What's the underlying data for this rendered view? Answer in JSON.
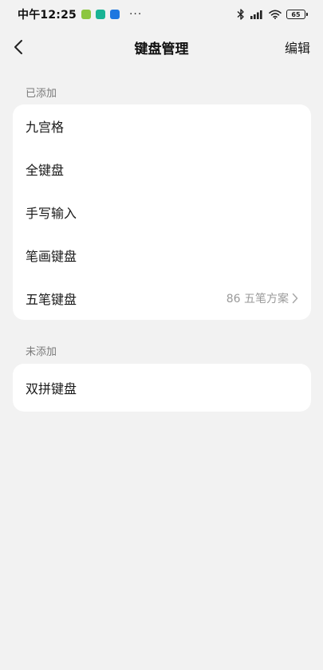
{
  "status_bar": {
    "time": "中午12:25",
    "dots": "···",
    "battery": "65"
  },
  "header": {
    "title": "键盘管理",
    "edit_label": "编辑"
  },
  "sections": {
    "added": {
      "label": "已添加",
      "items": [
        {
          "label": "九宫格"
        },
        {
          "label": "全键盘"
        },
        {
          "label": "手写输入"
        },
        {
          "label": "笔画键盘"
        },
        {
          "label": "五笔键盘",
          "detail": "86 五笔方案"
        }
      ]
    },
    "not_added": {
      "label": "未添加",
      "items": [
        {
          "label": "双拼键盘"
        }
      ]
    }
  },
  "icons": {
    "back": "chevron-left-icon",
    "detail_arrow": "chevron-right-icon",
    "bluetooth": "bluetooth-icon",
    "signal": "cell-signal-icon",
    "wifi": "wifi-icon",
    "battery": "battery-icon"
  }
}
